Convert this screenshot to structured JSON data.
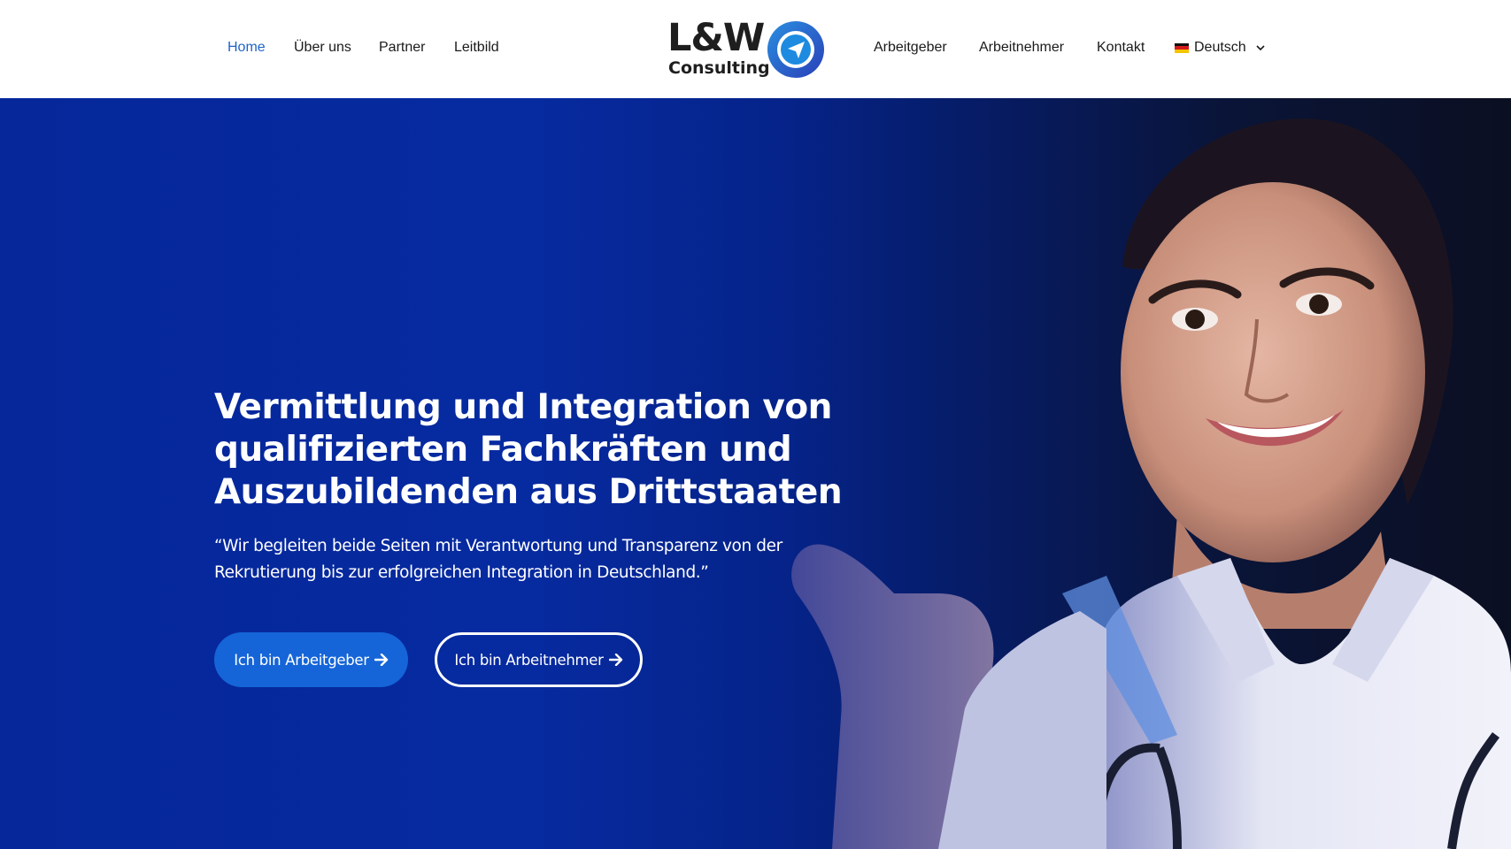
{
  "header": {
    "nav_left": [
      {
        "label": "Home",
        "active": true
      },
      {
        "label": "Über uns",
        "active": false
      },
      {
        "label": "Partner",
        "active": false
      },
      {
        "label": "Leitbild",
        "active": false
      }
    ],
    "nav_right": [
      {
        "label": "Arbeitgeber"
      },
      {
        "label": "Arbeitnehmer"
      },
      {
        "label": "Kontakt"
      }
    ],
    "language": {
      "label": "Deutsch",
      "flag_icon": "german-flag-icon"
    },
    "logo": {
      "mark": "L&W",
      "sub": "Consulting",
      "icon": "paper-plane-icon"
    }
  },
  "hero": {
    "headline_lines": [
      "Vermittlung und Integration von",
      "qualifizierten Fachkräften und",
      "Auszubildenden aus Drittstaaten"
    ],
    "quote_lines": [
      "“Wir begleiten beide Seiten mit Verantwortung und Transparenz von der",
      "Rekrutierung bis zur erfolgreichen Integration in Deutschland.”"
    ],
    "buttons": [
      {
        "label": "Ich bin Arbeitgeber",
        "icon": "arrow-right-icon"
      },
      {
        "label": "Ich bin Arbeitnehmer",
        "icon": "arrow-right-icon"
      }
    ]
  },
  "colors": {
    "accent": "#1f63c9",
    "button_primary": "#1565d8",
    "hero_blue": "#05279a",
    "hero_dark": "#0b0f22",
    "text_dark": "#1a1a1a"
  }
}
